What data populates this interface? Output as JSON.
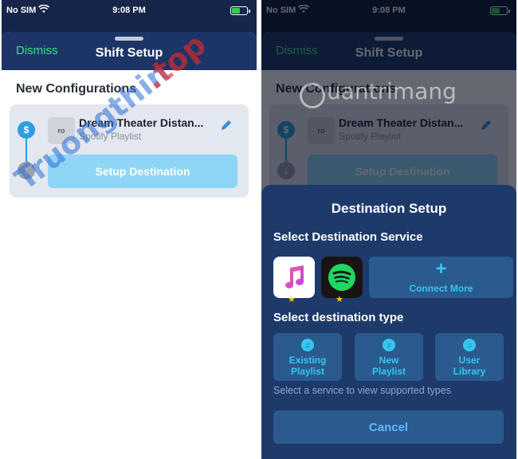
{
  "status_bar": {
    "carrier": "No SIM",
    "time": "9:08 PM",
    "battery_level": 0.55
  },
  "left_screen": {
    "header": {
      "dismiss_label": "Dismiss",
      "title": "Shift Setup"
    },
    "section_title": "New Configurations",
    "config": {
      "playlist_name": "Dream Theater Distan...",
      "playlist_source": "Spotify Playlist",
      "thumb_text": "ro",
      "setup_button": "Setup Destination"
    }
  },
  "right_screen": {
    "modal": {
      "title": "Destination Setup",
      "service_section": "Select Destination Service",
      "services": [
        {
          "name": "apple-music-icon"
        },
        {
          "name": "spotify-icon"
        }
      ],
      "connect_more_label": "Connect More",
      "type_section": "Select destination type",
      "types": [
        {
          "label": "Existing\nPlaylist"
        },
        {
          "label": "New\nPlaylist"
        },
        {
          "label": "User\nLibrary"
        }
      ],
      "hint": "Select a service to view supported types",
      "cancel_label": "Cancel"
    }
  },
  "watermarks": {
    "left": "Truongthin.top",
    "right": "uantrimang"
  },
  "colors": {
    "header_bg": "#1c3566",
    "dismiss": "#3ddc84",
    "setup_button": "#8fd6f6",
    "modal_bg": "#1e3a6a",
    "option_bg": "#2a5a8e",
    "accent": "#35c6f0"
  }
}
